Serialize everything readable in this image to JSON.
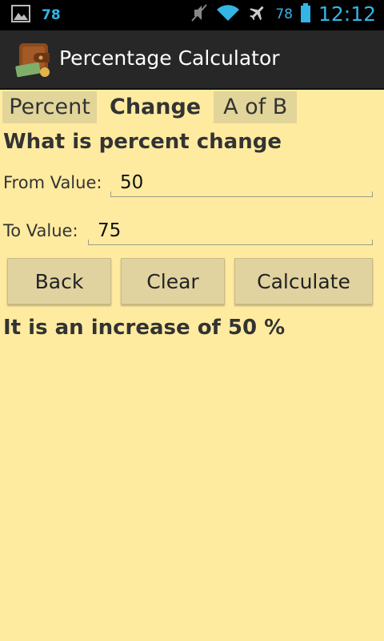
{
  "status_bar": {
    "notification_count": "78",
    "battery_level": "78",
    "clock": "12:12",
    "accent_color": "#33B5E5"
  },
  "action_bar": {
    "title": "Percentage Calculator",
    "icon": "wallet-icon"
  },
  "tabs": [
    {
      "label": "Percent",
      "active": false
    },
    {
      "label": "Change",
      "active": true
    },
    {
      "label": "A of B",
      "active": false
    }
  ],
  "form": {
    "heading": "What is percent change",
    "from_label": "From Value:",
    "from_value": "50",
    "to_label": "To Value:",
    "to_value": "75"
  },
  "buttons": {
    "back": "Back",
    "clear": "Clear",
    "calculate": "Calculate"
  },
  "result_text": "It is an increase of 50 %",
  "colors": {
    "background": "#FFEBA0",
    "action_bar": "#272727",
    "button": "#E0D3A0"
  }
}
